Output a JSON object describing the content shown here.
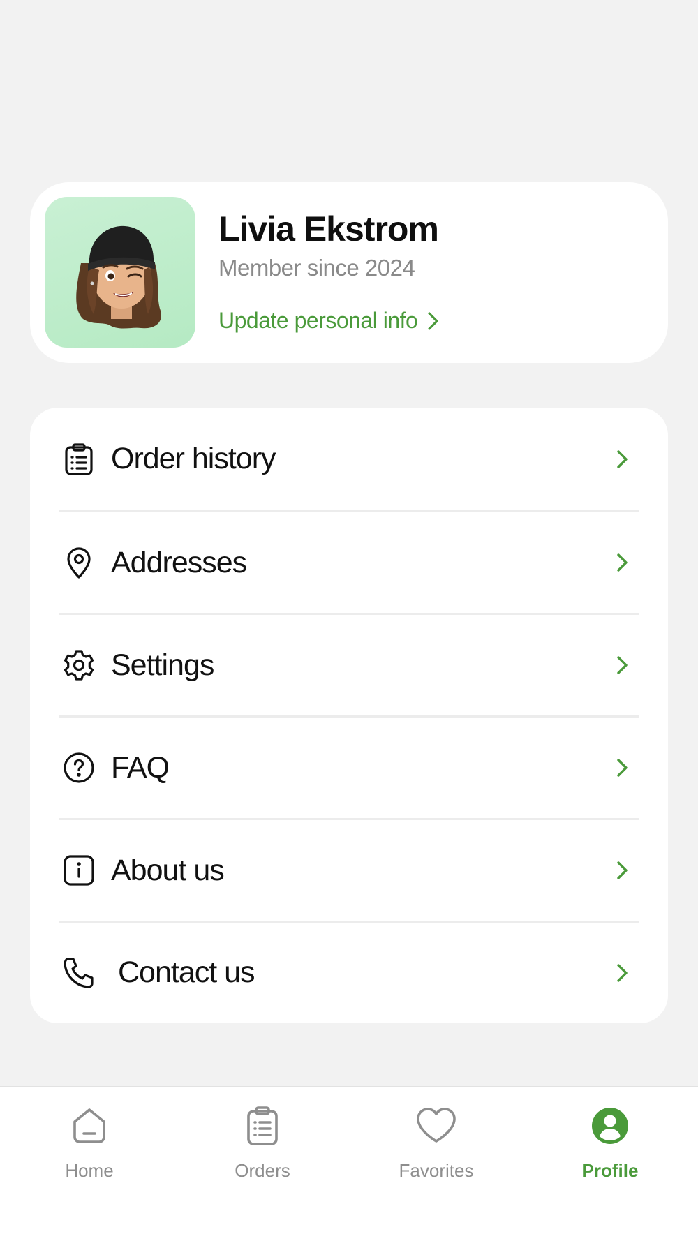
{
  "profile": {
    "name": "Livia Ekstrom",
    "member_since": "Member since 2024",
    "update_link": "Update personal info"
  },
  "menu": {
    "items": [
      {
        "label": "Order history",
        "icon": "clipboard-list-icon"
      },
      {
        "label": "Addresses",
        "icon": "map-pin-icon"
      },
      {
        "label": "Settings",
        "icon": "gear-icon"
      },
      {
        "label": "FAQ",
        "icon": "question-circle-icon"
      },
      {
        "label": "About us",
        "icon": "info-square-icon"
      },
      {
        "label": "Contact us",
        "icon": "phone-icon"
      }
    ]
  },
  "tabbar": {
    "tabs": [
      {
        "label": "Home",
        "icon": "home-icon",
        "active": false
      },
      {
        "label": "Orders",
        "icon": "clipboard-list-icon",
        "active": false
      },
      {
        "label": "Favorites",
        "icon": "heart-icon",
        "active": false
      },
      {
        "label": "Profile",
        "icon": "user-circle-icon",
        "active": true
      }
    ]
  },
  "colors": {
    "accent": "#4a9a3a",
    "background": "#f2f2f2",
    "card": "#ffffff",
    "avatar_bg": "#c4efd0",
    "inactive": "#8e8e8e"
  }
}
